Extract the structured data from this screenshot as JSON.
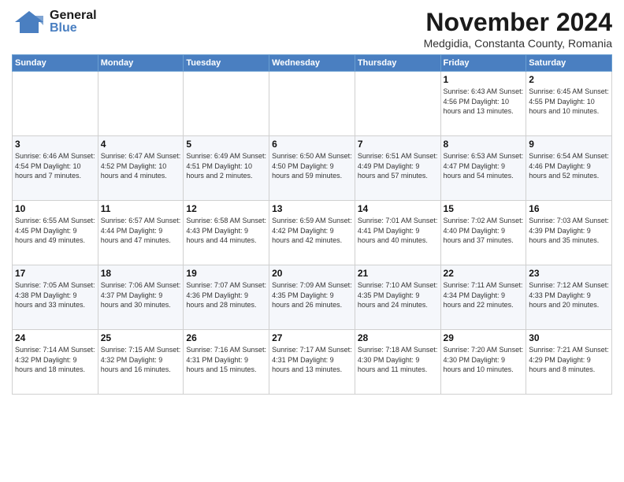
{
  "header": {
    "logo_general": "General",
    "logo_blue": "Blue",
    "month_title": "November 2024",
    "subtitle": "Medgidia, Constanta County, Romania"
  },
  "columns": [
    "Sunday",
    "Monday",
    "Tuesday",
    "Wednesday",
    "Thursday",
    "Friday",
    "Saturday"
  ],
  "weeks": [
    [
      {
        "day": "",
        "info": ""
      },
      {
        "day": "",
        "info": ""
      },
      {
        "day": "",
        "info": ""
      },
      {
        "day": "",
        "info": ""
      },
      {
        "day": "",
        "info": ""
      },
      {
        "day": "1",
        "info": "Sunrise: 6:43 AM\nSunset: 4:56 PM\nDaylight: 10 hours and 13 minutes."
      },
      {
        "day": "2",
        "info": "Sunrise: 6:45 AM\nSunset: 4:55 PM\nDaylight: 10 hours and 10 minutes."
      }
    ],
    [
      {
        "day": "3",
        "info": "Sunrise: 6:46 AM\nSunset: 4:54 PM\nDaylight: 10 hours and 7 minutes."
      },
      {
        "day": "4",
        "info": "Sunrise: 6:47 AM\nSunset: 4:52 PM\nDaylight: 10 hours and 4 minutes."
      },
      {
        "day": "5",
        "info": "Sunrise: 6:49 AM\nSunset: 4:51 PM\nDaylight: 10 hours and 2 minutes."
      },
      {
        "day": "6",
        "info": "Sunrise: 6:50 AM\nSunset: 4:50 PM\nDaylight: 9 hours and 59 minutes."
      },
      {
        "day": "7",
        "info": "Sunrise: 6:51 AM\nSunset: 4:49 PM\nDaylight: 9 hours and 57 minutes."
      },
      {
        "day": "8",
        "info": "Sunrise: 6:53 AM\nSunset: 4:47 PM\nDaylight: 9 hours and 54 minutes."
      },
      {
        "day": "9",
        "info": "Sunrise: 6:54 AM\nSunset: 4:46 PM\nDaylight: 9 hours and 52 minutes."
      }
    ],
    [
      {
        "day": "10",
        "info": "Sunrise: 6:55 AM\nSunset: 4:45 PM\nDaylight: 9 hours and 49 minutes."
      },
      {
        "day": "11",
        "info": "Sunrise: 6:57 AM\nSunset: 4:44 PM\nDaylight: 9 hours and 47 minutes."
      },
      {
        "day": "12",
        "info": "Sunrise: 6:58 AM\nSunset: 4:43 PM\nDaylight: 9 hours and 44 minutes."
      },
      {
        "day": "13",
        "info": "Sunrise: 6:59 AM\nSunset: 4:42 PM\nDaylight: 9 hours and 42 minutes."
      },
      {
        "day": "14",
        "info": "Sunrise: 7:01 AM\nSunset: 4:41 PM\nDaylight: 9 hours and 40 minutes."
      },
      {
        "day": "15",
        "info": "Sunrise: 7:02 AM\nSunset: 4:40 PM\nDaylight: 9 hours and 37 minutes."
      },
      {
        "day": "16",
        "info": "Sunrise: 7:03 AM\nSunset: 4:39 PM\nDaylight: 9 hours and 35 minutes."
      }
    ],
    [
      {
        "day": "17",
        "info": "Sunrise: 7:05 AM\nSunset: 4:38 PM\nDaylight: 9 hours and 33 minutes."
      },
      {
        "day": "18",
        "info": "Sunrise: 7:06 AM\nSunset: 4:37 PM\nDaylight: 9 hours and 30 minutes."
      },
      {
        "day": "19",
        "info": "Sunrise: 7:07 AM\nSunset: 4:36 PM\nDaylight: 9 hours and 28 minutes."
      },
      {
        "day": "20",
        "info": "Sunrise: 7:09 AM\nSunset: 4:35 PM\nDaylight: 9 hours and 26 minutes."
      },
      {
        "day": "21",
        "info": "Sunrise: 7:10 AM\nSunset: 4:35 PM\nDaylight: 9 hours and 24 minutes."
      },
      {
        "day": "22",
        "info": "Sunrise: 7:11 AM\nSunset: 4:34 PM\nDaylight: 9 hours and 22 minutes."
      },
      {
        "day": "23",
        "info": "Sunrise: 7:12 AM\nSunset: 4:33 PM\nDaylight: 9 hours and 20 minutes."
      }
    ],
    [
      {
        "day": "24",
        "info": "Sunrise: 7:14 AM\nSunset: 4:32 PM\nDaylight: 9 hours and 18 minutes."
      },
      {
        "day": "25",
        "info": "Sunrise: 7:15 AM\nSunset: 4:32 PM\nDaylight: 9 hours and 16 minutes."
      },
      {
        "day": "26",
        "info": "Sunrise: 7:16 AM\nSunset: 4:31 PM\nDaylight: 9 hours and 15 minutes."
      },
      {
        "day": "27",
        "info": "Sunrise: 7:17 AM\nSunset: 4:31 PM\nDaylight: 9 hours and 13 minutes."
      },
      {
        "day": "28",
        "info": "Sunrise: 7:18 AM\nSunset: 4:30 PM\nDaylight: 9 hours and 11 minutes."
      },
      {
        "day": "29",
        "info": "Sunrise: 7:20 AM\nSunset: 4:30 PM\nDaylight: 9 hours and 10 minutes."
      },
      {
        "day": "30",
        "info": "Sunrise: 7:21 AM\nSunset: 4:29 PM\nDaylight: 9 hours and 8 minutes."
      }
    ]
  ]
}
